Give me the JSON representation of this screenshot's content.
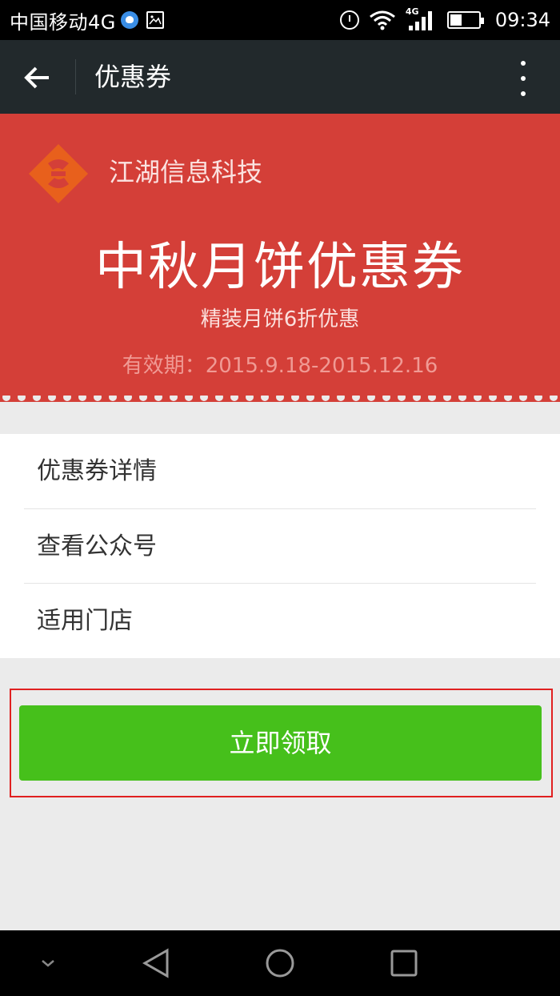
{
  "status_bar": {
    "carrier": "中国移动4G",
    "network_badge": "4G",
    "time": "09:34",
    "icons": [
      "app-notification-icon",
      "image-icon",
      "alarm-icon",
      "wifi-icon",
      "signal-icon",
      "battery-icon"
    ]
  },
  "app_bar": {
    "title": "优惠券",
    "back_icon": "arrow-left-icon",
    "more_icon": "more-vertical-icon"
  },
  "coupon": {
    "merchant_name": "江湖信息科技",
    "title": "中秋月饼优惠券",
    "subtitle": "精装月饼6折优惠",
    "validity": "有效期：2015.9.18-2015.12.16",
    "colors": {
      "background": "#d43f38",
      "logo": "#e8601c"
    }
  },
  "menu": {
    "items": [
      {
        "label": "优惠券详情"
      },
      {
        "label": "查看公众号"
      },
      {
        "label": "适用门店"
      }
    ]
  },
  "claim_button": {
    "label": "立即领取",
    "color": "#46c01b"
  },
  "nav_bar": {
    "icons": [
      "chevron-down-icon",
      "back-triangle-icon",
      "home-circle-icon",
      "recents-square-icon"
    ]
  }
}
